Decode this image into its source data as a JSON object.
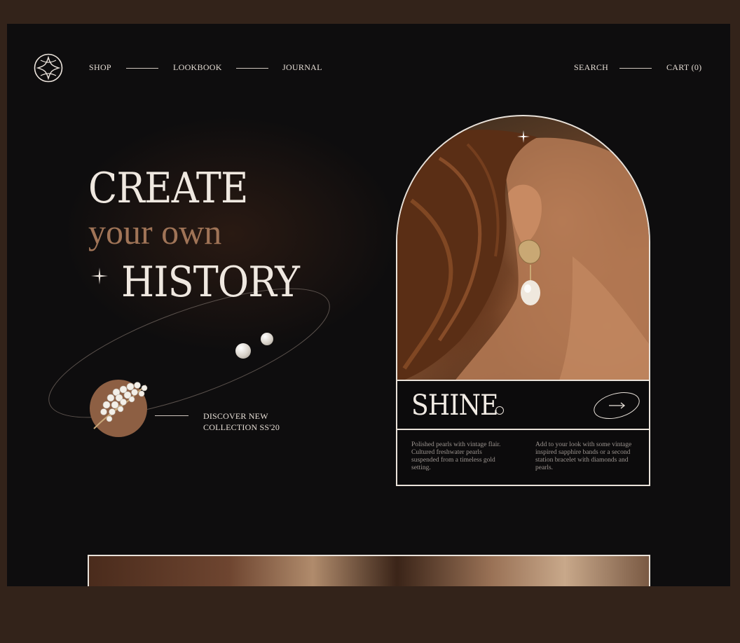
{
  "nav": {
    "left": [
      "SHOP",
      "LOOKBOOK",
      "JOURNAL"
    ],
    "search": "SEARCH",
    "cart": "CART (0)"
  },
  "hero": {
    "line1": "CREATE",
    "line2": "your own",
    "line3": "HISTORY"
  },
  "discover": {
    "line1": "DISCOVER NEW",
    "line2": "COLLECTION SS'20"
  },
  "card": {
    "title": "SHINE",
    "desc_left": "Polished pearls with vintage flair. Cultured freshwater pearls suspended from a timeless gold setting.",
    "desc_right": "Add to your look with some vintage inspired sapphire bands or a second station bracelet with diamonds and pearls."
  },
  "colors": {
    "background": "#0e0d0e",
    "outer": "#33231a",
    "accent_brown": "#a07457",
    "text_light": "#efe8e0"
  },
  "icons": [
    "logo-icon",
    "sparkle-icon",
    "arrow-right-icon"
  ]
}
